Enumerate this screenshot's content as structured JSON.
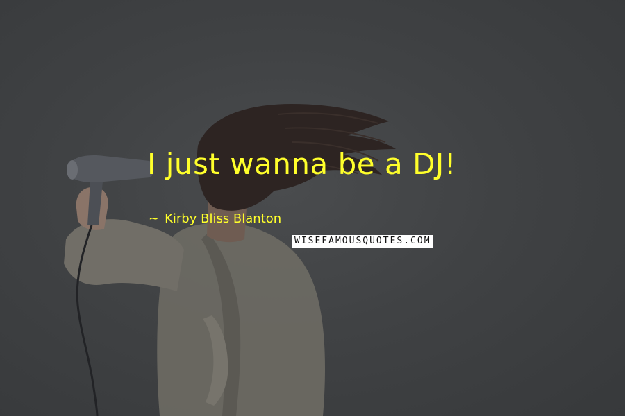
{
  "quote": {
    "text": "I just wanna be a DJ!",
    "author_prefix": "~",
    "author": "Kirby Bliss Blanton"
  },
  "watermark": {
    "text": "WISEFAMOUSQUOTES.COM"
  },
  "colors": {
    "background": "#3c3e40",
    "quote_text": "#ffff2b",
    "watermark_bg": "#ffffff"
  },
  "image": {
    "subject": "woman-blow-drying-hair-icon"
  }
}
